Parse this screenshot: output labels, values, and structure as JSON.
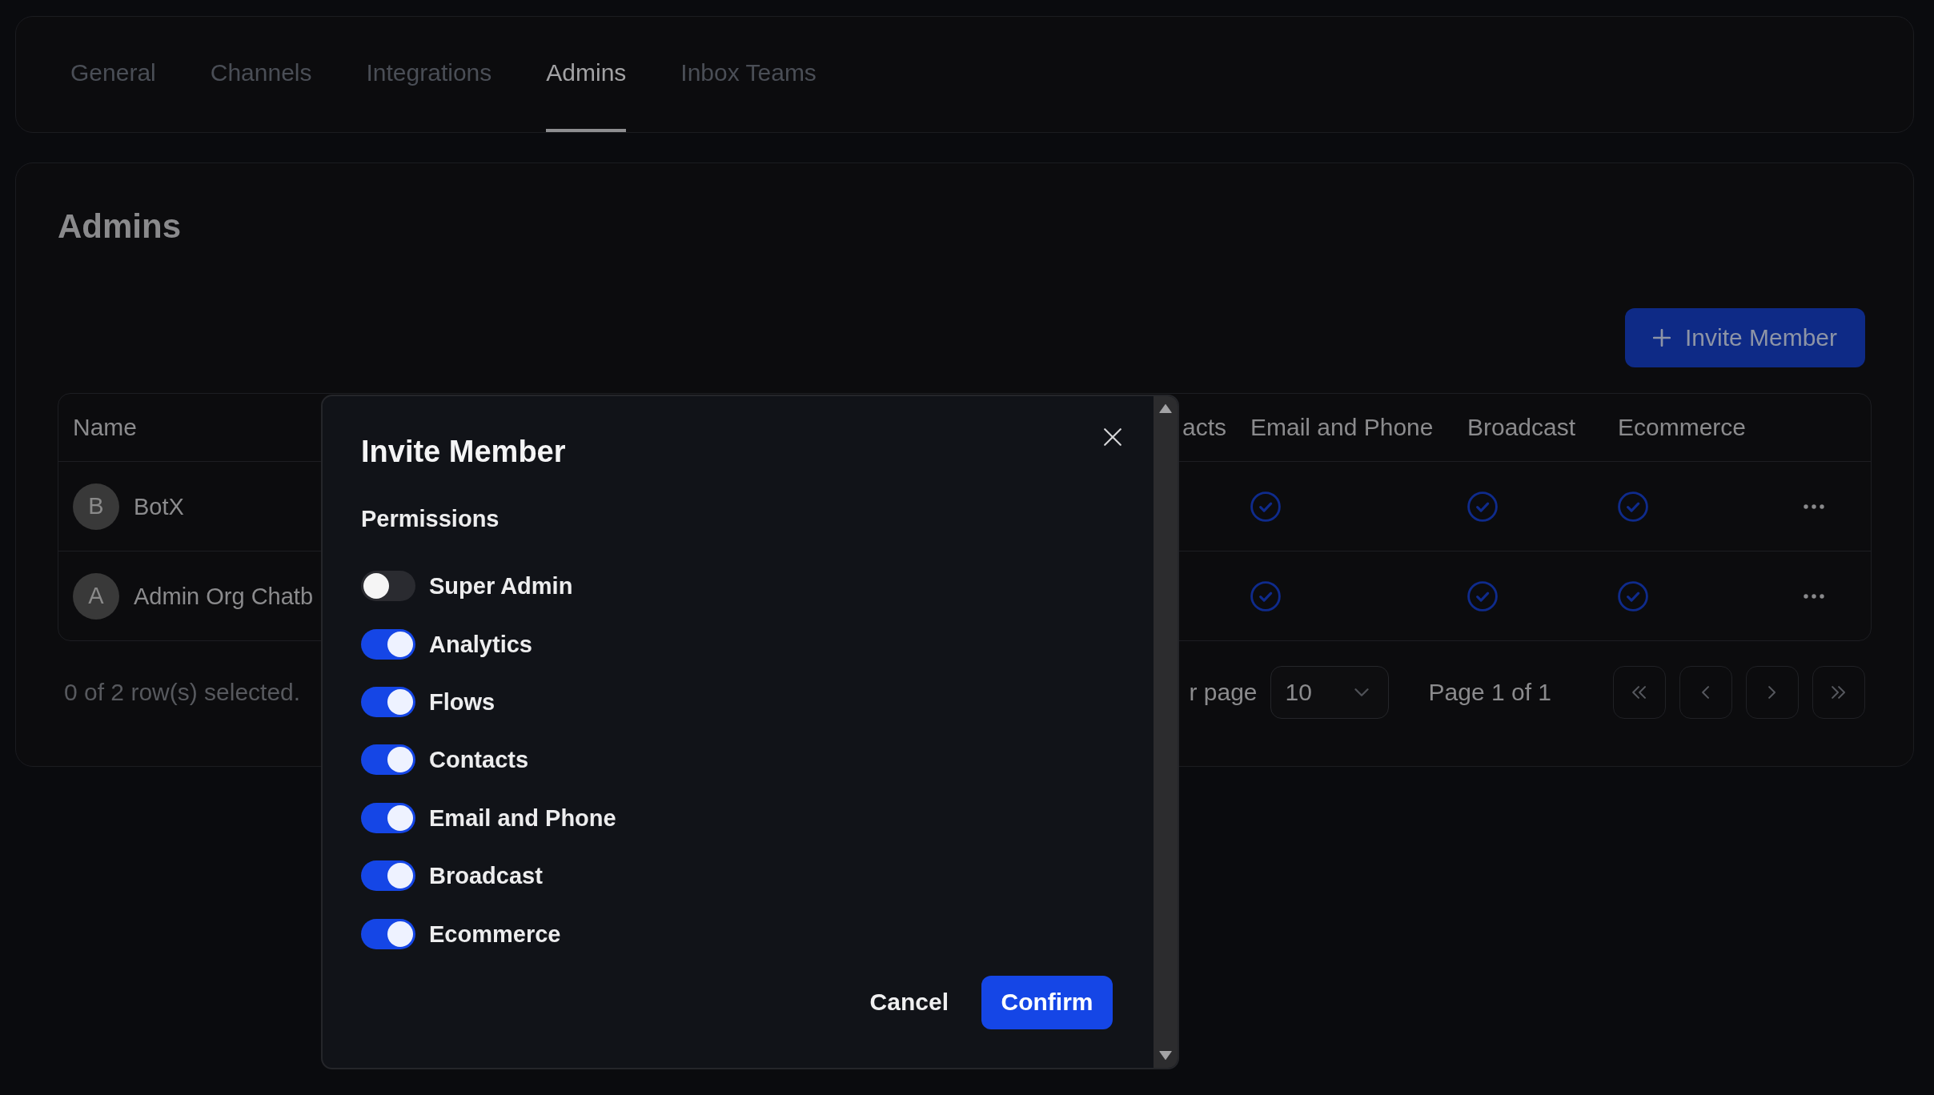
{
  "tabs": [
    {
      "label": "General",
      "selected": false
    },
    {
      "label": "Channels",
      "selected": false
    },
    {
      "label": "Integrations",
      "selected": false
    },
    {
      "label": "Admins",
      "selected": true
    },
    {
      "label": "Inbox Teams",
      "selected": false
    }
  ],
  "admins": {
    "title": "Admins",
    "invite_button": "Invite Member",
    "table": {
      "columns": [
        "Name",
        "acts",
        "Email and Phone",
        "Broadcast",
        "Ecommerce"
      ],
      "rows": [
        {
          "initial": "B",
          "name": "BotX",
          "permissions": [
            {
              "checked": true
            },
            {
              "checked": true
            },
            {
              "checked": true
            }
          ]
        },
        {
          "initial": "A",
          "name": "Admin Org Chatb",
          "permissions": [
            {
              "checked": true
            },
            {
              "checked": true
            },
            {
              "checked": true
            }
          ]
        }
      ]
    },
    "footer": {
      "selection": "0 of 2 row(s) selected.",
      "rows_per_page_label": "r page",
      "page_size": "10",
      "page_info": "Page 1 of 1"
    }
  },
  "dialog": {
    "title": "Invite Member",
    "section_label": "Permissions",
    "permissions": [
      {
        "label": "Super Admin",
        "on": false
      },
      {
        "label": "Analytics",
        "on": true
      },
      {
        "label": "Flows",
        "on": true
      },
      {
        "label": "Contacts",
        "on": true
      },
      {
        "label": "Email and Phone",
        "on": true
      },
      {
        "label": "Broadcast",
        "on": true
      },
      {
        "label": "Ecommerce",
        "on": true
      }
    ],
    "buttons": [
      {
        "label": "Cancel",
        "kind": "cancel"
      },
      {
        "label": "Confirm",
        "kind": "confirm"
      }
    ]
  }
}
